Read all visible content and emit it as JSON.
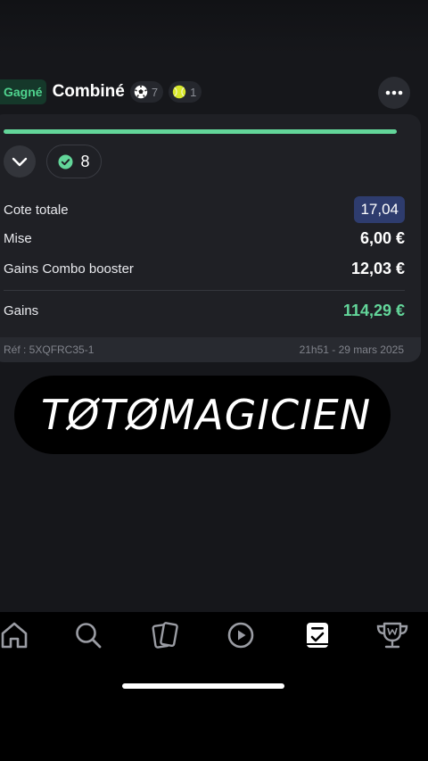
{
  "bet": {
    "status": "Gagné",
    "type": "Combiné",
    "sports": [
      {
        "icon": "soccer-ball-icon",
        "count": "7"
      },
      {
        "icon": "tennis-ball-icon",
        "count": "1"
      }
    ],
    "progress": 1.0,
    "won_selections": "8",
    "rows": {
      "total_odds": {
        "label": "Cote totale",
        "value": "17,04"
      },
      "stake": {
        "label": "Mise",
        "value": "6,00 €"
      },
      "booster": {
        "label": "Gains Combo booster",
        "value": "12,03 €"
      },
      "winnings": {
        "label": "Gains",
        "value": "114,29 €"
      }
    },
    "reference": "Réf : 5XQFRC35-1",
    "datetime": "21h51 - 29 mars 2025"
  },
  "watermark": "TØTØMAGICIEN",
  "nav": {
    "items": [
      "home-icon",
      "search-icon",
      "cards-icon",
      "play-icon",
      "betslip-icon",
      "trophy-icon"
    ],
    "active": "betslip-icon"
  },
  "colors": {
    "accent_green": "#63d69a",
    "odds_blue": "#2e3c6e",
    "background": "#16171b"
  }
}
